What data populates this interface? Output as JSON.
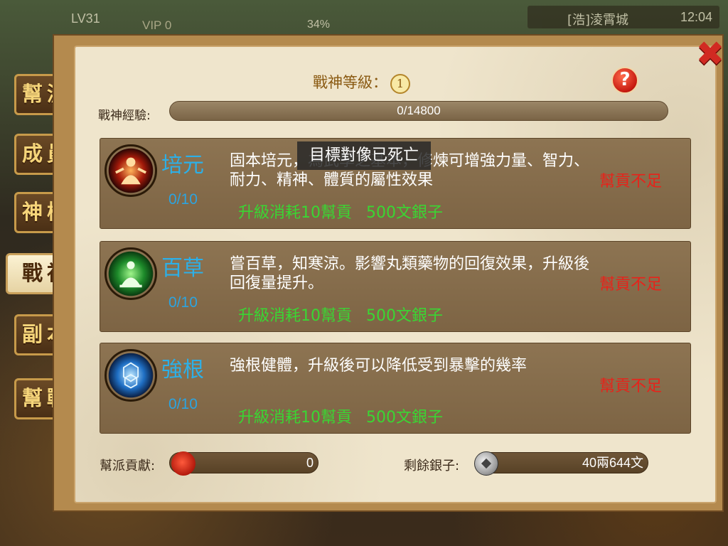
{
  "hud": {
    "level": "LV31",
    "vip": "VIP 0",
    "progress_percent": "34%",
    "location": "[浩]淩霄城",
    "time": "12:04"
  },
  "tabs": [
    {
      "label": "幫派",
      "active": false
    },
    {
      "label": "成員",
      "active": false
    },
    {
      "label": "神樹",
      "active": false
    },
    {
      "label": "戰神",
      "active": true
    },
    {
      "label": "副本",
      "active": false
    },
    {
      "label": "幫戰",
      "active": false
    }
  ],
  "dialog": {
    "title_prefix": "戰神等級：",
    "title_level": "1",
    "help_symbol": "?",
    "close_symbol": "✖",
    "exp_label": "戰神經驗:",
    "exp_value": "0/14800",
    "exp_fraction": 0.0,
    "toast": "目標對像已死亡"
  },
  "skills": [
    {
      "name": "培元",
      "level": "0/10",
      "desc": "固本培元，為武學之基本，修煉可增強力量、智力、耐力、精神、體質的屬性效果",
      "cost_contribution": "升級消耗10幫貢",
      "cost_silver": "500文銀子",
      "status": "幫貢不足",
      "icon": "meditation-fire-icon"
    },
    {
      "name": "百草",
      "level": "0/10",
      "desc": "嘗百草，知寒涼。影響丸類藥物的回復效果，升級後回復量提升。",
      "cost_contribution": "升級消耗10幫貢",
      "cost_silver": "500文銀子",
      "status": "幫貢不足",
      "icon": "meditation-herb-icon"
    },
    {
      "name": "強根",
      "level": "0/10",
      "desc": "強根健體，升級後可以降低受到暴擊的幾率",
      "cost_contribution": "升級消耗10幫貢",
      "cost_silver": "500文銀子",
      "status": "幫貢不足",
      "icon": "turtle-shell-icon"
    }
  ],
  "footer": {
    "contribution_label": "幫派貢獻:",
    "contribution_value": "0",
    "silver_label": "剩餘銀子:",
    "silver_value": "40兩644文"
  },
  "colors": {
    "skill_name": "#2cb0e8",
    "cost_text": "#3ad633",
    "status_text": "#e8221a"
  }
}
